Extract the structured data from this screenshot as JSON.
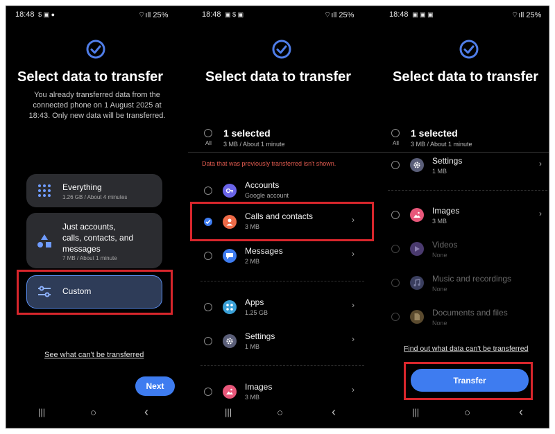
{
  "status_bar": {
    "time": "18:48",
    "battery": "25%"
  },
  "common": {
    "title": "Select data to transfer",
    "nav": {
      "recents": "|||",
      "home": "○",
      "back": "‹"
    }
  },
  "panel1": {
    "subtitle_lines": [
      "You already transferred data from the",
      "connected phone on 1 August 2025 at",
      "18:43. Only new data will be transferred."
    ],
    "options": [
      {
        "title": "Everything",
        "sub": "1.26 GB / About 4 minutes"
      },
      {
        "title_lines": [
          "Just accounts,",
          "calls, contacts, and",
          "messages"
        ],
        "sub": "7 MB / About 1 minute"
      },
      {
        "title": "Custom"
      }
    ],
    "link": "See what can't be transferred",
    "next_button": "Next"
  },
  "panel2": {
    "selected_title": "1 selected",
    "selected_sub": "3 MB / About 1 minute",
    "all_label": "All",
    "notice": "Data that was previously transferred isn't shown.",
    "items": [
      {
        "title": "Accounts",
        "sub": "Google account",
        "icon": "key-icon",
        "color": "#6a64e8"
      },
      {
        "title": "Calls and contacts",
        "sub": "3 MB",
        "icon": "person-icon",
        "color": "#ee6a47",
        "checked": true
      },
      {
        "title": "Messages",
        "sub": "2 MB",
        "icon": "chat-icon",
        "color": "#3e7cf0"
      },
      {
        "title": "Apps",
        "sub": "1.25 GB",
        "icon": "apps-grid-icon",
        "color": "#3aa1d8"
      },
      {
        "title": "Settings",
        "sub": "1 MB",
        "icon": "gear-icon",
        "color": "#5a5e78"
      },
      {
        "title": "Images",
        "sub": "3 MB",
        "icon": "image-icon",
        "color": "#e8577a"
      }
    ]
  },
  "panel3": {
    "selected_title": "1 selected",
    "selected_sub": "3 MB / About 1 minute",
    "all_label": "All",
    "items": [
      {
        "title": "Settings",
        "sub": "1 MB",
        "icon": "gear-icon",
        "color": "#5a5e78"
      },
      {
        "title": "Images",
        "sub": "3 MB",
        "icon": "image-icon",
        "color": "#e8577a"
      },
      {
        "title": "Videos",
        "sub": "None",
        "icon": "play-icon",
        "color": "#4a3a6e"
      },
      {
        "title": "Music and recordings",
        "sub": "None",
        "icon": "music-icon",
        "color": "#3a3e5e"
      },
      {
        "title": "Documents and files",
        "sub": "None",
        "icon": "document-icon",
        "color": "#5a4a2e"
      }
    ],
    "link": "Find out what data can't be transferred",
    "transfer_button": "Transfer"
  }
}
